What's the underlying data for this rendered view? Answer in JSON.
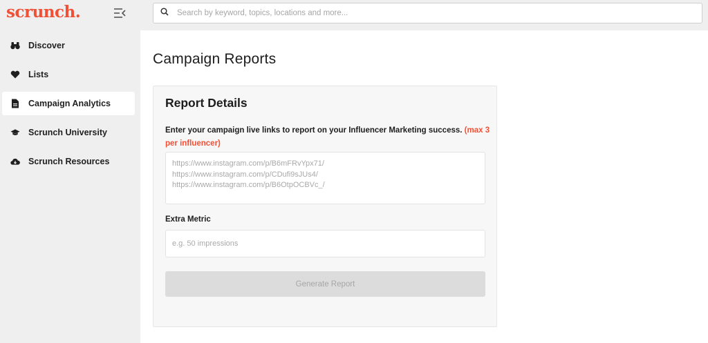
{
  "brand": {
    "logo_text": "scrunch.",
    "logo_color": "#ef5036"
  },
  "sidebar": {
    "items": [
      {
        "label": "Discover",
        "icon": "binoculars-icon",
        "active": false
      },
      {
        "label": "Lists",
        "icon": "heart-icon",
        "active": false
      },
      {
        "label": "Campaign Analytics",
        "icon": "document-icon",
        "active": true
      },
      {
        "label": "Scrunch University",
        "icon": "graduation-cap-icon",
        "active": false
      },
      {
        "label": "Scrunch Resources",
        "icon": "cloud-download-icon",
        "active": false
      }
    ]
  },
  "search": {
    "placeholder": "Search by keyword, topics, locations and more...",
    "value": ""
  },
  "page": {
    "title": "Campaign Reports"
  },
  "report": {
    "title": "Report Details",
    "description": "Enter your campaign live links to report on your Influencer Marketing success.",
    "description_hint": "(max 3 per influencer)",
    "links_placeholder": "https://www.instagram.com/p/B6mFRvYpx71/\nhttps://www.instagram.com/p/CDufi9sJUs4/\nhttps://www.instagram.com/p/B6OtpOCBVc_/",
    "metric_label": "Extra Metric",
    "metric_placeholder": "e.g. 50 impressions",
    "button_label": "Generate Report"
  },
  "colors": {
    "accent": "#ef5036",
    "sidebar_bg": "#efefef",
    "button_disabled": "#dcdcdc"
  }
}
